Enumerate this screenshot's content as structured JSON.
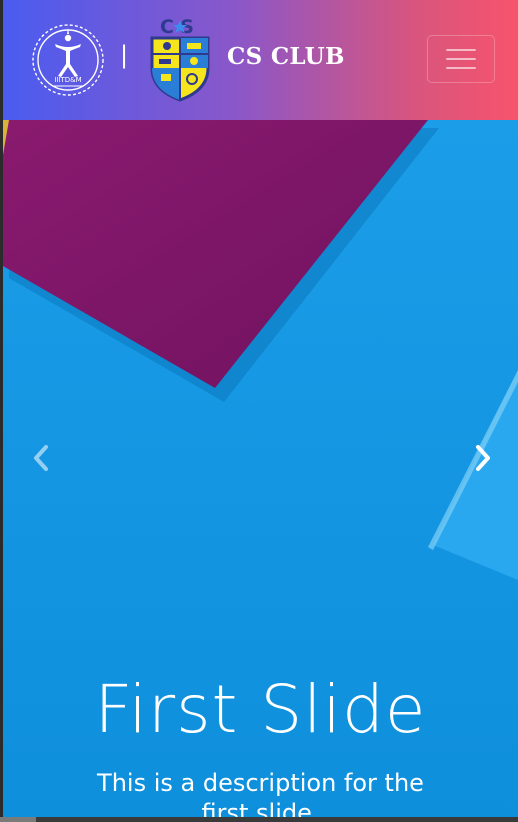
{
  "navbar": {
    "separator": "|",
    "club_name": "CS CLUB",
    "menu_icon": "hamburger-menu-icon",
    "gradient_start": "#4a5cf0",
    "gradient_end": "#f7546c"
  },
  "logos": {
    "institute_logo_text": "IIITD&M",
    "club_logo_text": "CS"
  },
  "carousel": {
    "prev_icon": "chevron-left-icon",
    "next_icon": "chevron-right-icon",
    "slide": {
      "title": "First Slide",
      "description": "This is a description for the first slide."
    },
    "colors": {
      "blue": "#1c9ae6",
      "purple": "#7c1467"
    }
  }
}
